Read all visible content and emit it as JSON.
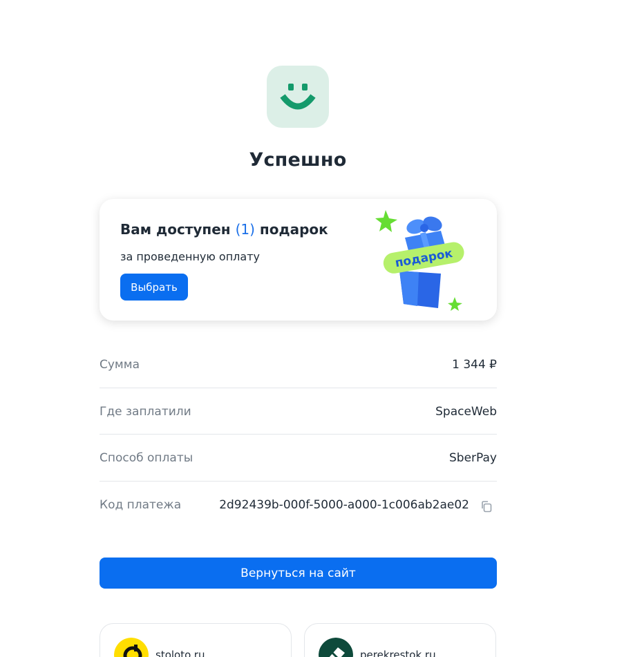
{
  "status": {
    "title": "Успешно",
    "icon": "smile-icon",
    "icon_color": "#149a6b"
  },
  "gift": {
    "title_prefix": "Вам доступен ",
    "count": "(1)",
    "title_suffix": " подарок",
    "subtitle": "за проведенную оплату",
    "button_label": "Выбрать",
    "art_label": "подарок"
  },
  "details": {
    "sum_label": "Сумма",
    "sum_value": "1 344 ₽",
    "merchant_label": "Где заплатили",
    "merchant_value": "SpaceWeb",
    "method_label": "Способ оплаты",
    "method_value": "SberPay",
    "code_label": "Код платежа",
    "code_value": "2d92439b-000f-5000-a000-1c006ab2ae02"
  },
  "return_button": "Вернуться на сайт",
  "partners": [
    {
      "name": "stoloto.ru"
    },
    {
      "name": "perekrestok.ru"
    }
  ],
  "colors": {
    "accent": "#0a6ef0",
    "brand_green": "#149a6b",
    "logo_bg": "#dcefe7"
  }
}
